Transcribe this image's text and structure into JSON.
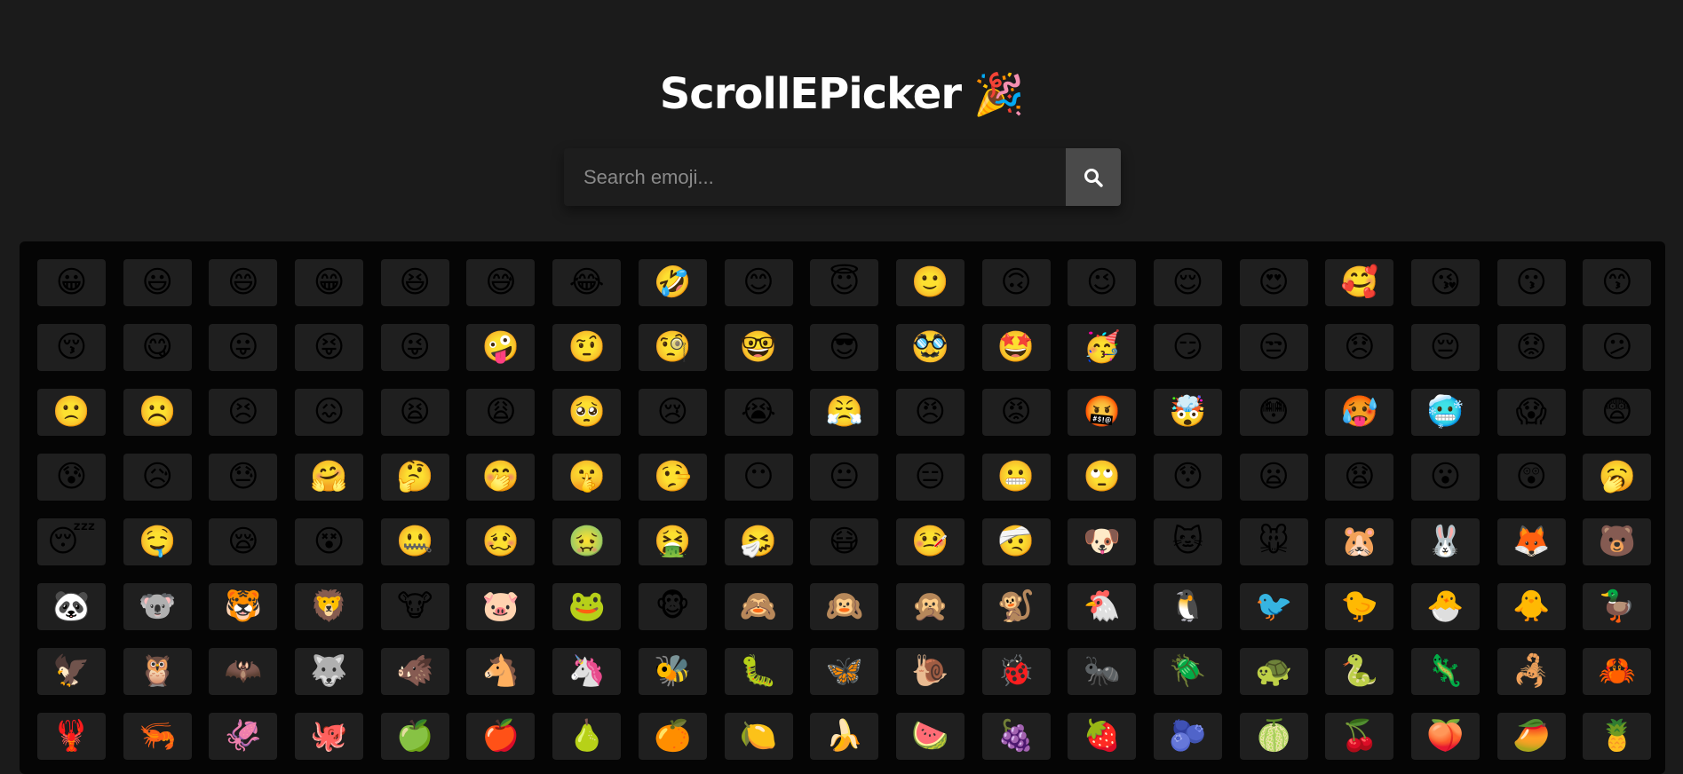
{
  "header": {
    "title": "ScrollEPicker",
    "title_emoji": "🎉"
  },
  "search": {
    "placeholder": "Search emoji...",
    "button_icon": "search-icon"
  },
  "colors": {
    "page_background": "#1b1b1b",
    "panel_background": "#050505",
    "cell_background": "#1f1f1f",
    "search_button": "#4a4a4a",
    "title": "#ffffff"
  },
  "emojis": [
    "😀",
    "😃",
    "😄",
    "😁",
    "😆",
    "😅",
    "😂",
    "🤣",
    "😊",
    "😇",
    "🙂",
    "🙃",
    "😉",
    "😌",
    "😍",
    "🥰",
    "😘",
    "😗",
    "😙",
    "😚",
    "😋",
    "😛",
    "😝",
    "😜",
    "🤪",
    "🤨",
    "🧐",
    "🤓",
    "😎",
    "🥸",
    "🤩",
    "🥳",
    "😏",
    "😒",
    "😞",
    "😔",
    "😟",
    "😕",
    "🙁",
    "☹️",
    "😣",
    "😖",
    "😫",
    "😩",
    "🥺",
    "😢",
    "😭",
    "😤",
    "😠",
    "😡",
    "🤬",
    "🤯",
    "😳",
    "🥵",
    "🥶",
    "😱",
    "😨",
    "😰",
    "😥",
    "😓",
    "🤗",
    "🤔",
    "🤭",
    "🤫",
    "🤥",
    "😶",
    "😐",
    "😑",
    "😬",
    "🙄",
    "😯",
    "😦",
    "😧",
    "😮",
    "😲",
    "🥱",
    "😴",
    "🤤",
    "😪",
    "😵",
    "🤐",
    "🥴",
    "🤢",
    "🤮",
    "🤧",
    "😷",
    "🤒",
    "🤕",
    "🐶",
    "🐱",
    "🐭",
    "🐹",
    "🐰",
    "🦊",
    "🐻",
    "🐼",
    "🐨",
    "🐯",
    "🦁",
    "🐮",
    "🐷",
    "🐸",
    "🐵",
    "🙈",
    "🙉",
    "🙊",
    "🐒",
    "🐔",
    "🐧",
    "🐦",
    "🐤",
    "🐣",
    "🐥",
    "🦆",
    "🦅",
    "🦉",
    "🦇",
    "🐺",
    "🐗",
    "🐴",
    "🦄",
    "🐝",
    "🐛",
    "🦋",
    "🐌",
    "🐞",
    "🐜",
    "🪲",
    "🐢",
    "🐍",
    "🦎",
    "🦂",
    "🦀",
    "🦞",
    "🦐",
    "🦑",
    "🐙",
    "🍏",
    "🍎",
    "🍐",
    "🍊",
    "🍋",
    "🍌",
    "🍉",
    "🍇",
    "🍓",
    "🫐",
    "🍈",
    "🍒",
    "🍑",
    "🥭",
    "🍍"
  ]
}
